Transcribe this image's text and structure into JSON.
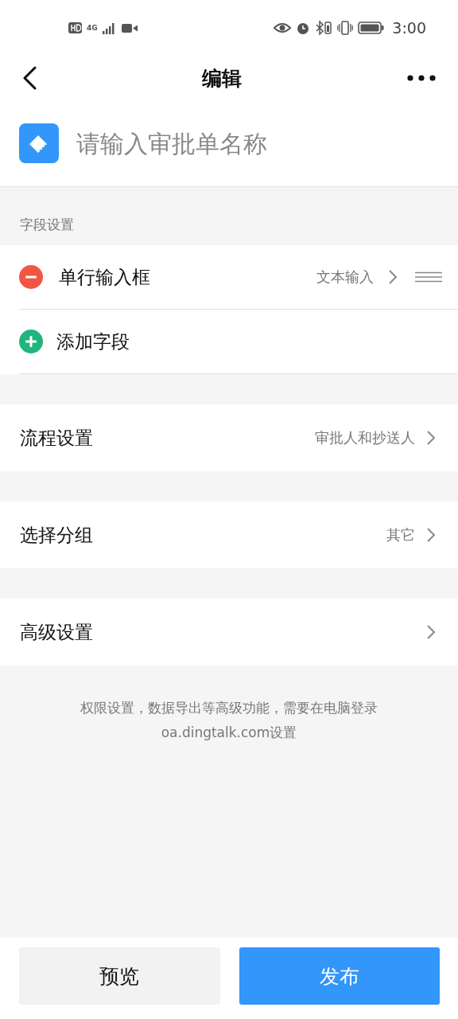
{
  "status_bar": {
    "time": "3:00",
    "network": "4G"
  },
  "nav": {
    "title": "编辑"
  },
  "header": {
    "placeholder": "请输入审批单名称"
  },
  "field_section": {
    "label": "字段设置",
    "items": [
      {
        "kind": "field",
        "label": "单行输入框",
        "value": "文本输入"
      },
      {
        "kind": "add",
        "label": "添加字段"
      }
    ]
  },
  "settings": [
    {
      "label": "流程设置",
      "value": "审批人和抄送人"
    },
    {
      "label": "选择分组",
      "value": "其它"
    },
    {
      "label": "高级设置"
    }
  ],
  "note": {
    "line1": "权限设置，数据导出等高级功能，需要在电脑登录",
    "line2": "oa.dingtalk.com设置"
  },
  "footer": [
    {
      "kind": "secondary",
      "label": "预览"
    },
    {
      "kind": "primary",
      "label": "发布"
    }
  ]
}
